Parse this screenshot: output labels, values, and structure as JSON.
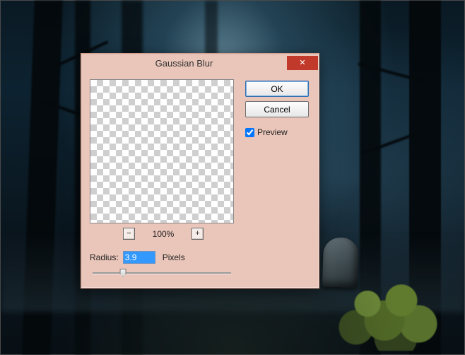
{
  "dialog": {
    "title": "Gaussian Blur",
    "close_icon": "✕",
    "ok_label": "OK",
    "cancel_label": "Cancel",
    "preview_label": "Preview",
    "preview_checked": true,
    "zoom": {
      "out_icon": "−",
      "in_icon": "+",
      "value": "100%"
    },
    "radius": {
      "label": "Radius:",
      "value": "3.9",
      "unit": "Pixels",
      "slider_percent": 22
    }
  }
}
